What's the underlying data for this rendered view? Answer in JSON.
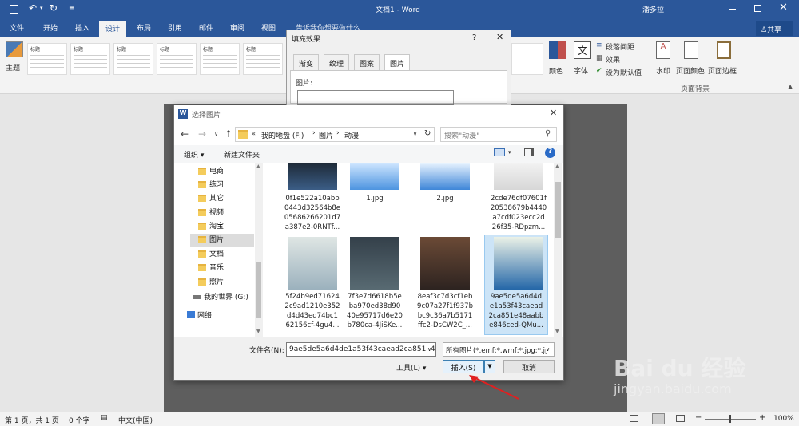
{
  "titlebar": {
    "title": "文档1 - Word",
    "user": "潘多拉"
  },
  "ribbon_tabs": [
    "文件",
    "开始",
    "插入",
    "设计",
    "布局",
    "引用",
    "邮件",
    "审阅",
    "视图"
  ],
  "tell_me": "告诉我你想要做什么",
  "share": "共享",
  "ribbon": {
    "theme_label": "主题",
    "style_title": "标题",
    "colors_label": "颜色",
    "fonts_label": "字体",
    "para_spacing": "段落间距",
    "effects": "效果",
    "set_default": "设为默认值",
    "watermark": "水印",
    "page_color": "页面颜色",
    "page_border": "页面边框",
    "group_page_bg": "页面背景"
  },
  "fill_dialog": {
    "title": "填充效果",
    "help": "?",
    "tabs": [
      "渐变",
      "纹理",
      "图案",
      "图片"
    ],
    "picture_label": "图片:"
  },
  "file_dialog": {
    "title": "选择图片",
    "path": [
      "我的地盘 (F:)",
      "图片",
      "动漫"
    ],
    "search_placeholder": "搜索\"动漫\"",
    "organize": "组织",
    "new_folder": "新建文件夹",
    "nav_items": [
      "电商",
      "练习",
      "其它",
      "视频",
      "淘宝",
      "图片",
      "文档",
      "音乐",
      "照片"
    ],
    "drive": "我的世界 (G:)",
    "network": "网络",
    "files_row1": [
      "0f1e522a10abb\n0443d32564b8e\n05686266201d7\na387e2-0RNTf...",
      "1.jpg",
      "2.jpg",
      "2cde76df07601f\n20538679b4440\na7cdf023ecc2d\n26f35-RDpzm..."
    ],
    "files_row2": [
      "5f24b9ed71624\n2c9ad1210e352\nd4d43ed74bc1\n62156cf-4gu4...",
      "7f3e7d6618b5e\nba970ed38d90\n40e95717d6e20\nb780ca-4JiSKe...",
      "8eaf3c7d3cf1eb\n9c07a27f1f937b\nbc9c36a7b5171\nffc2-DsCW2C_...",
      "9ae5de5a6d4d\ne1a53f43caead\n2ca851e48aabb\ne846ced-QMu..."
    ],
    "filename_label": "文件名(N):",
    "filename_value": "9ae5de5a6d4de1a53f43caead2ca851e48",
    "filetype_value": "所有图片(*.emf;*.wmf;*.jpg;*.jp",
    "tools": "工具(L)",
    "insert": "插入(S)",
    "cancel": "取消"
  },
  "status": {
    "page": "第 1 页，共 1 页",
    "words": "0 个字",
    "lang": "中文(中国)",
    "zoom": "100%"
  },
  "watermark": {
    "line1": "Bai du 经验",
    "line2": "jingyan.baidu.com"
  }
}
